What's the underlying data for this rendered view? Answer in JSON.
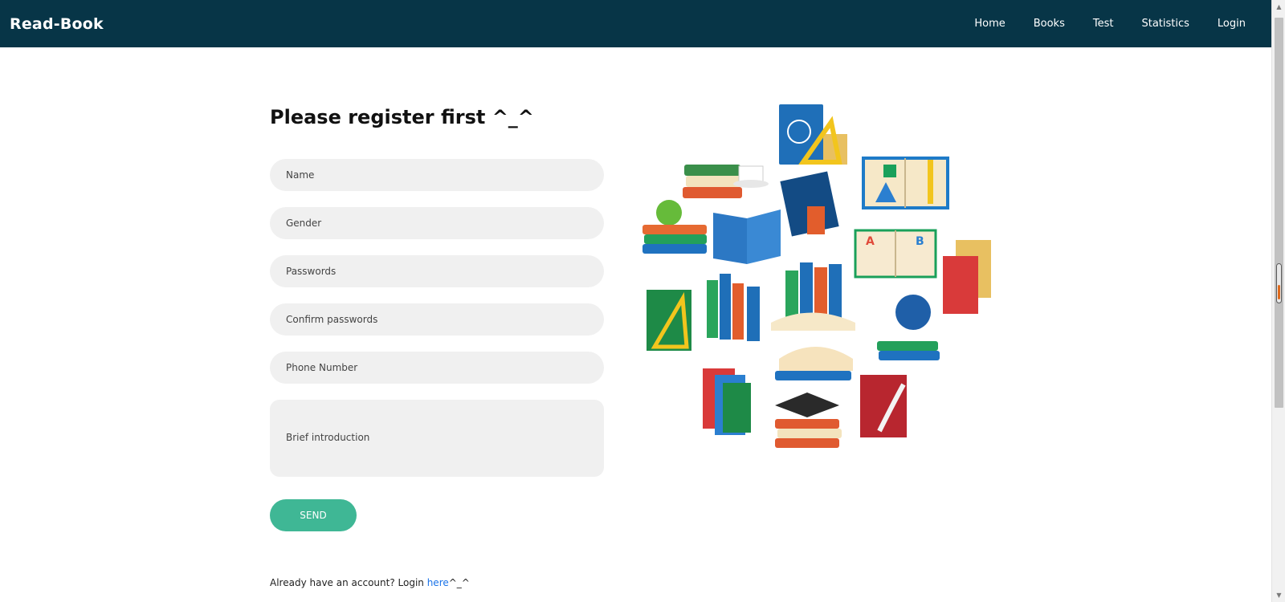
{
  "navbar": {
    "brand": "Read-Book",
    "items": [
      "Home",
      "Books",
      "Test",
      "Statistics",
      "Login"
    ]
  },
  "form": {
    "heading": "Please register first ^_^",
    "name_placeholder": "Name",
    "gender_placeholder": "Gender",
    "password_placeholder": "Passwords",
    "confirm_placeholder": "Confirm passwords",
    "phone_placeholder": "Phone Number",
    "intro_placeholder": "Brief introduction",
    "send_label": "SEND"
  },
  "login_prompt": {
    "text": "Already have an account? Login ",
    "link": "here",
    "suffix": "^_^"
  },
  "colors": {
    "navbar_bg": "#073547",
    "send_bg": "#3fb795",
    "field_bg": "#f0f0f0"
  }
}
